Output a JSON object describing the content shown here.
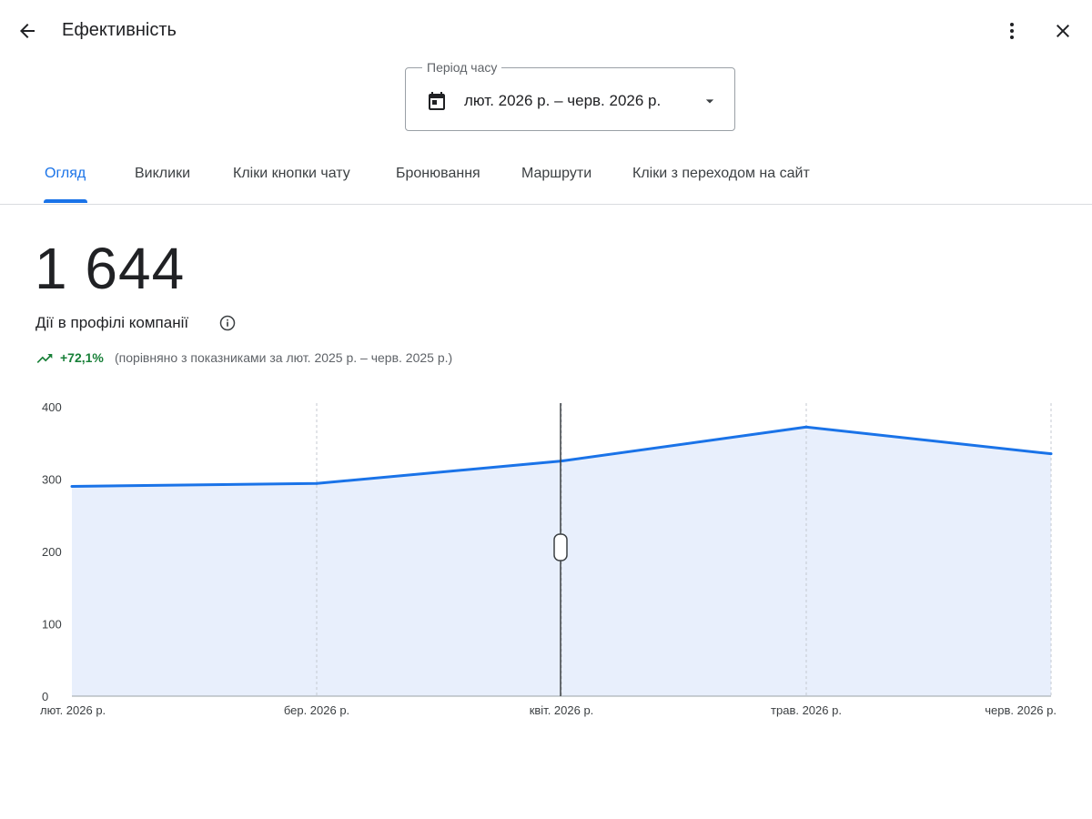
{
  "header": {
    "title": "Ефективність",
    "back_icon": "arrow-back-icon",
    "more_icon": "more-vert-icon",
    "close_icon": "close-icon"
  },
  "period": {
    "label": "Період часу",
    "value": "лют. 2026 р. – черв. 2026 р.",
    "icon": "calendar-icon"
  },
  "tabs": [
    {
      "label": "Огляд",
      "active": true
    },
    {
      "label": "Виклики",
      "active": false
    },
    {
      "label": "Кліки кнопки чату",
      "active": false
    },
    {
      "label": "Бронювання",
      "active": false
    },
    {
      "label": "Маршрути",
      "active": false
    },
    {
      "label": "Кліки з переходом на сайт",
      "active": false
    }
  ],
  "summary": {
    "total": "1 644",
    "label": "Дії в профілі компанії",
    "change": "+72,1%",
    "comparison": "(порівняно з показниками за лют. 2025 р. – черв. 2025 р.)"
  },
  "colors": {
    "accent": "#1a73e8",
    "positive": "#188038",
    "area_fill": "#e8effc"
  },
  "chart_data": {
    "type": "area",
    "x": [
      "лют. 2026 р.",
      "бер. 2026 р.",
      "квіт. 2026 р.",
      "трав. 2026 р.",
      "черв. 2026 р."
    ],
    "series": [
      {
        "values": [
          290,
          294,
          325,
          372,
          335
        ]
      }
    ],
    "yticks": [
      0,
      100,
      200,
      300,
      400
    ],
    "ylim": [
      0,
      400
    ],
    "grid": "vertical dashed",
    "cursor_at": "квіт. 2026 р."
  }
}
